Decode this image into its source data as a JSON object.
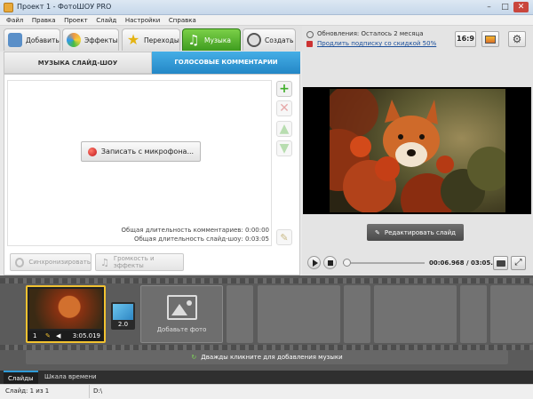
{
  "window": {
    "title": "Проект 1 - ФотоШОУ PRO"
  },
  "menu": [
    "Файл",
    "Правка",
    "Проект",
    "Слайд",
    "Настройки",
    "Справка"
  ],
  "tabs": [
    {
      "label": "Добавить",
      "icon": "photo-add-icon"
    },
    {
      "label": "Эффекты",
      "icon": "palette-icon"
    },
    {
      "label": "Переходы",
      "icon": "star-icon"
    },
    {
      "label": "Музыка",
      "icon": "music-note-icon",
      "active": true
    },
    {
      "label": "Создать",
      "icon": "film-reel-icon"
    }
  ],
  "subtabs": [
    "МУЗЫКА СЛАЙД-ШОУ",
    "ГОЛОСОВЫЕ КОММЕНТАРИИ"
  ],
  "record_button": "Записать с микрофона...",
  "info": {
    "comments_duration": "Общая длительность комментариев: 0:00:00",
    "slideshow_duration": "Общая длительность слайд-шоу: 0:03:05"
  },
  "bottom_buttons": {
    "sync": "Синхронизировать",
    "volume": "Громкость и эффекты"
  },
  "updates": {
    "text": "Обновления: Осталось 2 месяца",
    "link": "Продлить подписку со скидкой 50%"
  },
  "aspect_ratio": "16:9",
  "edit_slide": "Редактировать слайд",
  "player": {
    "time": "00:06.968 / 03:05.019"
  },
  "timeline": {
    "slide_number": "1",
    "slide_duration": "3:05.019",
    "transition_duration": "2.0",
    "add_photo": "Добавьте фото",
    "music_hint": "Дважды кликните для добавления музыки"
  },
  "bottom_tabs": [
    "Слайды",
    "Шкала времени"
  ],
  "status": {
    "slide": "Слайд: 1 из 1",
    "path": "D:\\"
  },
  "colors": {
    "accent_blue": "#2e9bd8",
    "active_tab_green": "#4caf28",
    "selected_slide": "#f2c230"
  }
}
